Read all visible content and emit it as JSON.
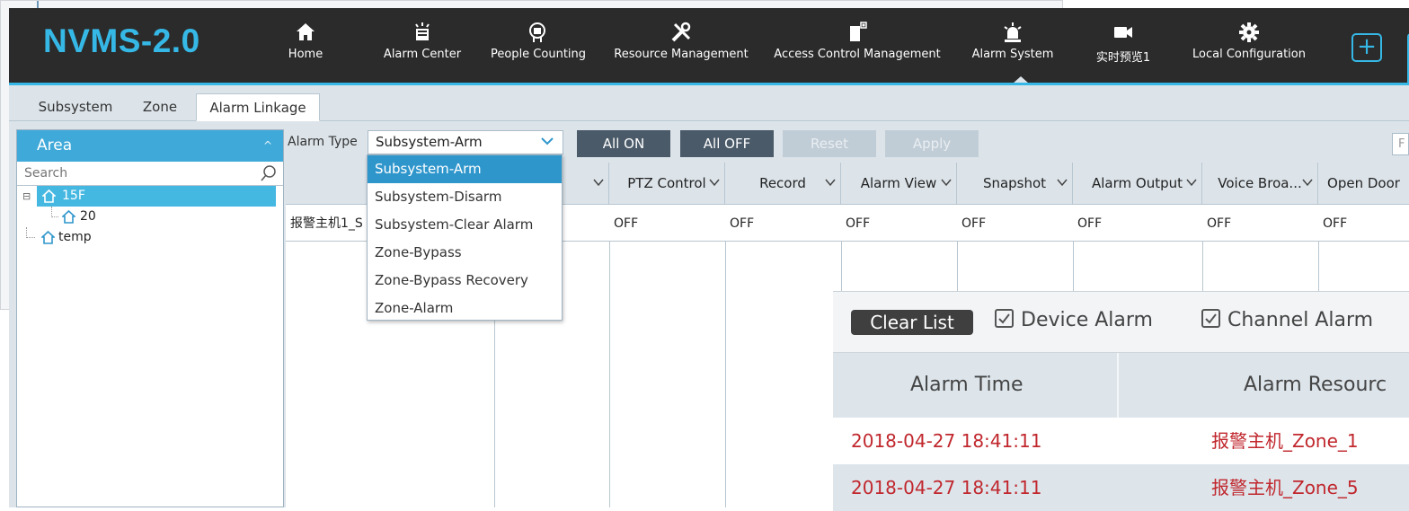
{
  "app": {
    "logo": "NVMS-2.0"
  },
  "colors": {
    "accent": "#36b8e6",
    "topbar": "#2b2b2b",
    "alarm_text": "#c0272d",
    "selected": "#2f96cc"
  },
  "nav": [
    {
      "label": "Home",
      "icon": "home-icon"
    },
    {
      "label": "Alarm Center",
      "icon": "alarm-center-icon"
    },
    {
      "label": "People Counting",
      "icon": "people-counting-icon"
    },
    {
      "label": "Resource Management",
      "icon": "tools-icon"
    },
    {
      "label": "Access Control Management",
      "icon": "access-control-icon"
    },
    {
      "label": "Alarm System",
      "icon": "siren-icon"
    },
    {
      "label": "实时预览1",
      "icon": "camera-icon"
    },
    {
      "label": "Local Configuration",
      "icon": "gear-icon"
    }
  ],
  "tabs": [
    "Subsystem",
    "Zone",
    "Alarm Linkage"
  ],
  "area": {
    "title": "Area",
    "search_placeholder": "Search",
    "tree": [
      "15F",
      "20",
      "temp"
    ]
  },
  "toolbar": {
    "alarm_type_label": "Alarm Type",
    "alarm_type_value": "Subsystem-Arm",
    "all_on": "All ON",
    "all_off": "All OFF",
    "reset": "Reset",
    "apply": "Apply",
    "filter": "F"
  },
  "dropdown": [
    "Subsystem-Arm",
    "Subsystem-Disarm",
    "Subsystem-Clear Alarm",
    "Zone-Bypass",
    "Zone-Bypass Recovery",
    "Zone-Alarm"
  ],
  "table": {
    "headers": [
      "PTZ Control",
      "Record",
      "Alarm View",
      "Snapshot",
      "Alarm Output",
      "Voice Broa...",
      "Open Door"
    ],
    "row": {
      "name": "报警主机1_S",
      "values": [
        "OFF",
        "OFF",
        "OFF",
        "OFF",
        "OFF",
        "OFF",
        "OFF"
      ]
    }
  },
  "alarm_panel": {
    "clear_list": "Clear List",
    "device_alarm": "Device Alarm",
    "channel_alarm": "Channel Alarm",
    "col_time": "Alarm Time",
    "col_resource": "Alarm Resourc",
    "rows": [
      {
        "time": "2018-04-27 18:41:11",
        "resource": "报警主机_Zone_1"
      },
      {
        "time": "2018-04-27 18:41:11",
        "resource": "报警主机_Zone_5"
      }
    ]
  }
}
